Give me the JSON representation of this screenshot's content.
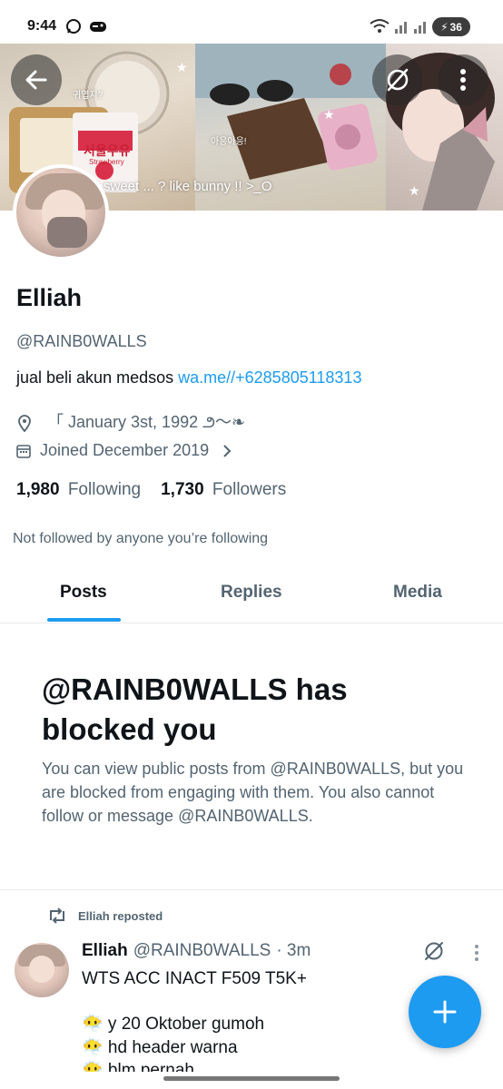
{
  "status_bar": {
    "time": "9:44",
    "battery": "36"
  },
  "banner": {
    "caption": "sweet ... ? like bunny !! >_O",
    "text_korean_left": "귀엽지?",
    "text_korean_middle": "아응아응!",
    "milk_label": "서울우유",
    "milk_sub": "Strawberry"
  },
  "profile": {
    "display_name": "Elliah",
    "handle": "@RAINB0WALLS",
    "bio_text": "jual beli akun medsos",
    "bio_link": "wa.me//+6285805118313",
    "location": "「 January 3st, 1992 ౨〜❧",
    "joined": "Joined December 2019",
    "following_count": "1,980",
    "following_label": "Following",
    "followers_count": "1,730",
    "followers_label": "Followers",
    "not_followed": "Not followed by anyone you’re following"
  },
  "tabs": [
    "Posts",
    "Replies",
    "Media"
  ],
  "blocked": {
    "title": "@RAINB0WALLS has blocked you",
    "description": "You can view public posts from @RAINB0WALLS, but you are blocked from engaging with them. You also cannot follow or message @RAINB0WALLS."
  },
  "post": {
    "repost_label": "Elliah reposted",
    "author": "Elliah",
    "handle": "@RAINB0WALLS",
    "time": "· 3m",
    "text": "WTS ACC INACT F509 T5K+",
    "line1": "😶‍🌫️ y 20 Oktober gumoh",
    "line2": "😶‍🌫️ hd header warna",
    "line3": "😶‍🌫️ blm pernah"
  },
  "colors": {
    "accent": "#1d9bf0",
    "text_primary": "#0f1419",
    "text_secondary": "#536471"
  }
}
